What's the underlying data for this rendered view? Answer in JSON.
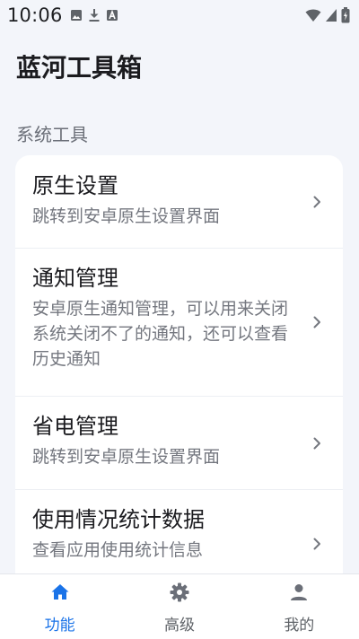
{
  "status_bar": {
    "time": "10:06",
    "notification_icons": [
      "image-icon",
      "download-icon",
      "font-a-icon"
    ],
    "system_icons": [
      "wifi-icon",
      "signal-icon",
      "battery-icon"
    ]
  },
  "header": {
    "title": "蓝河工具箱"
  },
  "section": {
    "label": "系统工具"
  },
  "items": [
    {
      "title": "原生设置",
      "description": "跳转到安卓原生设置界面"
    },
    {
      "title": "通知管理",
      "description": "安卓原生通知管理，可以用来关闭系统关闭不了的通知，还可以查看历史通知"
    },
    {
      "title": "省电管理",
      "description": "跳转到安卓原生设置界面"
    },
    {
      "title": "使用情况统计数据",
      "description": "查看应用使用统计信息"
    }
  ],
  "bottom_nav": {
    "tabs": [
      {
        "label": "功能",
        "icon": "home-icon",
        "active": true
      },
      {
        "label": "高级",
        "icon": "gear-icon",
        "active": false
      },
      {
        "label": "我的",
        "icon": "person-icon",
        "active": false
      }
    ]
  },
  "colors": {
    "accent": "#1a73e8",
    "background": "#f3f5fa",
    "card": "#ffffff",
    "text_primary": "#1b1b1f",
    "text_secondary": "#74777f"
  }
}
